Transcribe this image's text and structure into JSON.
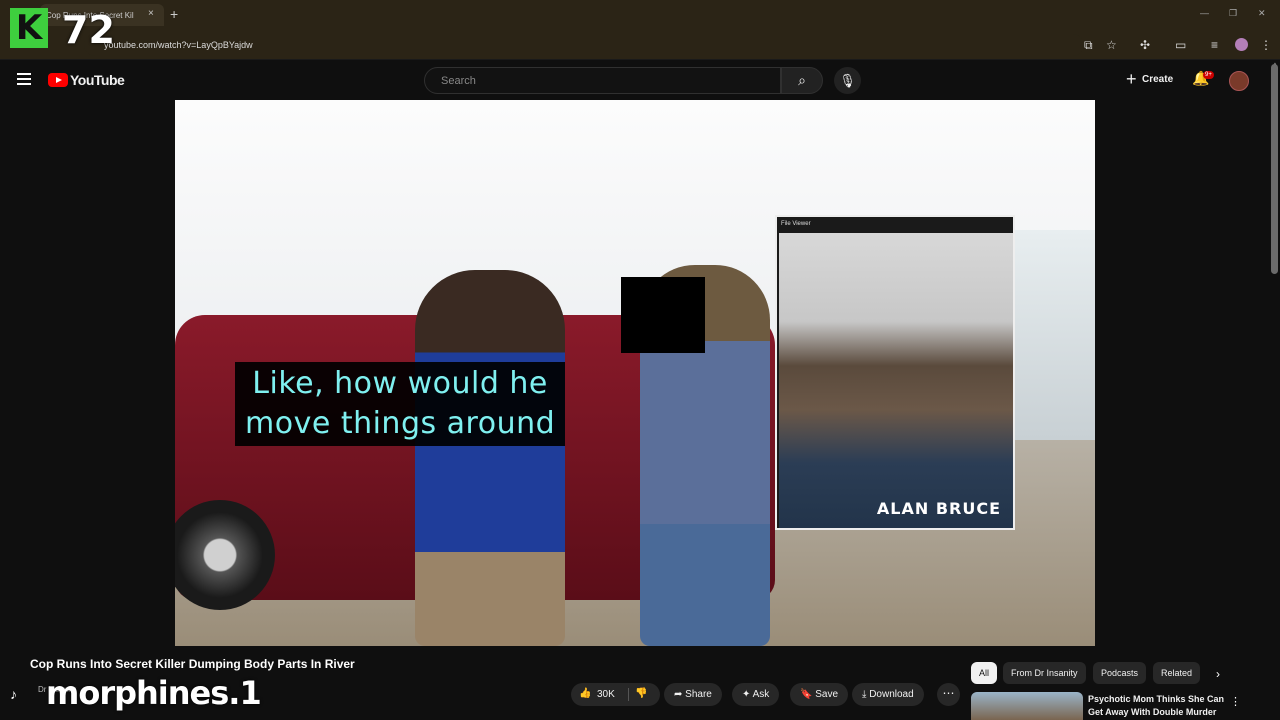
{
  "browser": {
    "tab_title": "Cop Runs Into Secret Kil",
    "tab_close": "×",
    "new_tab": "+",
    "url": "youtube.com/watch?v=LayQpBYajdw",
    "window_controls": [
      "—",
      "❐",
      "✕"
    ]
  },
  "overlay": {
    "logo_letter": "K",
    "logo_number": "72",
    "watermark": "morphines.1"
  },
  "header": {
    "brand": "YouTube",
    "search_placeholder": "Search",
    "search_icon": "⌕",
    "mic_icon": "🎙",
    "create_label": "Create",
    "create_icon": "+",
    "bell_icon": "🔔",
    "notification_count": "9+"
  },
  "video": {
    "subtitle_line1": "Like, how would he",
    "subtitle_line2": "move things around",
    "pip_title": "File Viewer",
    "pip_name": "ALAN BRUCE"
  },
  "info": {
    "title": "Cop Runs Into Secret Killer Dumping Body Parts In River",
    "channel": "Dr Insanity",
    "like_count": "30K",
    "like_icon": "👍",
    "dislike_icon": "👎",
    "share_label": "Share",
    "share_icon": "➦",
    "ask_label": "Ask",
    "ask_icon": "✦",
    "save_label": "Save",
    "save_icon": "🔖",
    "download_label": "Download",
    "download_icon": "⤓",
    "more_icon": "⋯"
  },
  "chips": [
    "All",
    "From Dr Insanity",
    "Podcasts",
    "Related"
  ],
  "chip_next_icon": "›",
  "recommendation": {
    "title": "Psychotic Mom Thinks She Can Get Away With Double Murder",
    "menu_icon": "⋮"
  }
}
